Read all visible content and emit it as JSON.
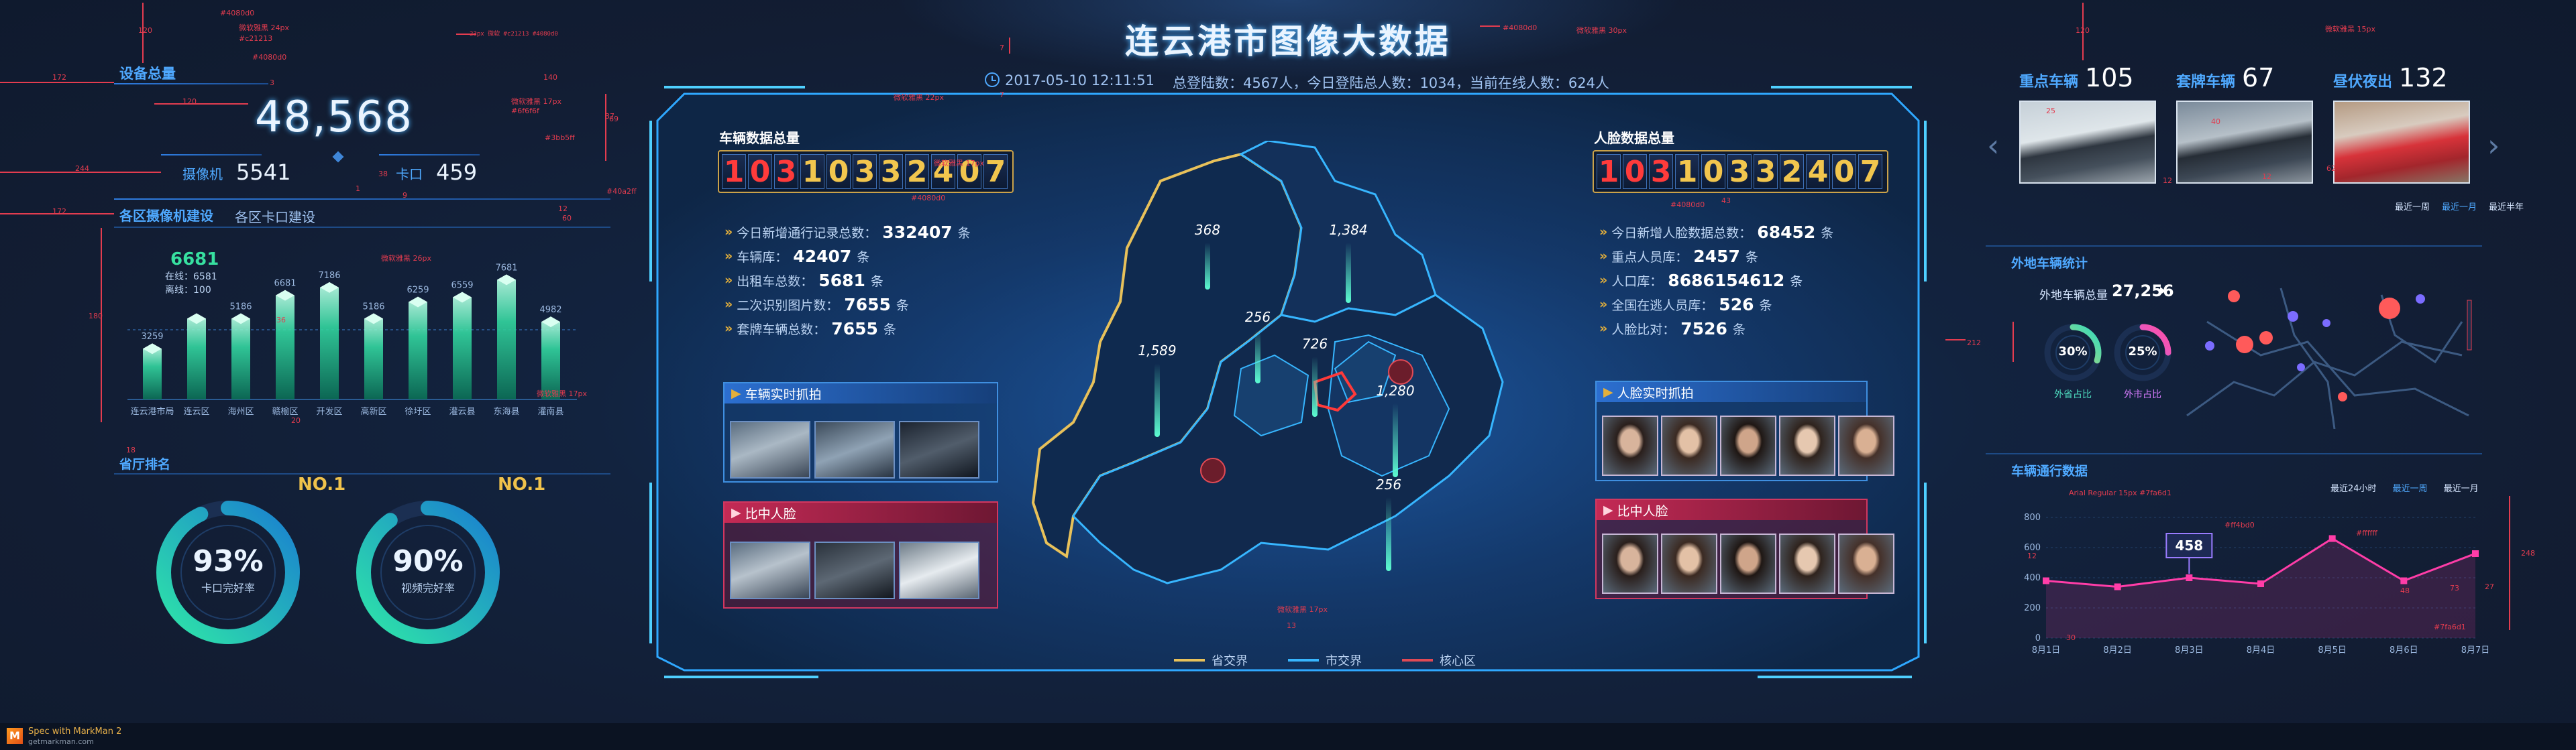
{
  "header": {
    "title": "连云港市图像大数据",
    "datetime": "2017-05-10 12:11:51",
    "stats": "总登陆数：4567人，今日登陆总人数：1034，当前在线人数：624人"
  },
  "left": {
    "device_total_title": "设备总量",
    "device_total": "48,568",
    "camera_label": "摄像机",
    "camera_count": "5541",
    "checkpoint_label": "卡口",
    "checkpoint_count": "459",
    "district_tab_1": "各区摄像机建设",
    "district_tab_2": "各区卡口建设",
    "highlight_value": "6681",
    "highlight_online": "在线：6581",
    "highlight_offline": "离线：100",
    "rank_title": "省厅排名",
    "gauges": [
      {
        "badge": "NO.1",
        "value": "93%",
        "label": "卡口完好率",
        "fraction": 0.93
      },
      {
        "badge": "NO.1",
        "value": "90%",
        "label": "视频完好率",
        "fraction": 0.9
      }
    ]
  },
  "chart_data": [
    {
      "type": "bar",
      "categories": [
        "连云港市局",
        "连云区",
        "海州区",
        "赣榆区",
        "开发区",
        "高新区",
        "徐圩区",
        "灌云县",
        "东海县",
        "灌南县"
      ],
      "values": [
        3259,
        5186,
        5186,
        6681,
        7186,
        5186,
        6259,
        6559,
        7681,
        4982
      ],
      "value_labels": [
        "3259",
        "",
        "5186",
        "6681",
        "7186",
        "5186",
        "6259",
        "6559",
        "7681",
        "4982"
      ],
      "ylim": [
        0,
        8000
      ]
    },
    {
      "type": "line",
      "title": "车辆通行数据",
      "categories": [
        "8月1日",
        "8月2日",
        "8月3日",
        "8月4日",
        "8月5日",
        "8月6日",
        "8月7日"
      ],
      "values": [
        380,
        340,
        400,
        360,
        660,
        380,
        560
      ],
      "highlight_label": "458",
      "ylim": [
        0,
        800
      ],
      "yticks": [
        "0",
        "200",
        "400",
        "600",
        "800"
      ]
    }
  ],
  "center": {
    "vehicle_title": "车辆数据总量",
    "vehicle_digits": [
      "1",
      "0",
      "3",
      "1",
      "0",
      "3",
      "3",
      "2",
      "4",
      "0",
      "7"
    ],
    "vehicle_stats": [
      {
        "label": "今日新增通行记录总数：",
        "value": "332407",
        "unit": "条"
      },
      {
        "label": "车辆库：",
        "value": "42407",
        "unit": "条"
      },
      {
        "label": "出租车总数：",
        "value": "5681",
        "unit": "条"
      },
      {
        "label": "二次识别图片数：",
        "value": "7655",
        "unit": "条"
      },
      {
        "label": "套牌车辆总数：",
        "value": "7655",
        "unit": "条"
      }
    ],
    "vehicle_capture_title": "车辆实时抓拍",
    "match_face_title": "比中人脸",
    "face_title": "人脸数据总量",
    "face_digits": [
      "1",
      "0",
      "3",
      "1",
      "0",
      "3",
      "3",
      "2",
      "4",
      "0",
      "7"
    ],
    "face_stats": [
      {
        "label": "今日新增人脸数据总数：",
        "value": "68452",
        "unit": "条"
      },
      {
        "label": "重点人员库：",
        "value": "2457",
        "unit": "条"
      },
      {
        "label": "人口库：",
        "value": "8686154612",
        "unit": "条"
      },
      {
        "label": "全国在逃人员库：",
        "value": "526",
        "unit": "条"
      },
      {
        "label": "人脸比对：",
        "value": "7526",
        "unit": "条"
      }
    ],
    "face_capture_title": "人脸实时抓拍",
    "match_face_title_2": "比中人脸",
    "map_values": [
      "368",
      "1,384",
      "256",
      "726",
      "1,589",
      "1,280",
      "256"
    ],
    "legend": [
      {
        "label": "省交界",
        "color": "#e8c15a"
      },
      {
        "label": "市交界",
        "color": "#37b6ff"
      },
      {
        "label": "核心区",
        "color": "#e04a55"
      }
    ]
  },
  "right": {
    "key_vehicle": {
      "label": "重点车辆",
      "value": "105"
    },
    "fake_plate": {
      "label": "套牌车辆",
      "value": "67"
    },
    "night_out": {
      "label": "昼伏夜出",
      "value": "132"
    },
    "periods": [
      "最近一周",
      "最近一月",
      "最近半年"
    ],
    "nonlocal_title": "外地车辆统计",
    "nonlocal_total_label": "外地车辆总量",
    "nonlocal_total": "27,256",
    "ring1": {
      "value": "30%",
      "label": "外省占比",
      "fraction": 0.3
    },
    "ring2": {
      "value": "25%",
      "label": "外市占比",
      "fraction": 0.25
    },
    "traffic_title": "车辆通行数据",
    "traffic_periods": [
      "最近24小时",
      "最近一周",
      "最近一月"
    ]
  },
  "footer": {
    "brand": "Spec with MarkMan 2",
    "url": "getmarkman.com"
  },
  "annotations": {
    "m1": "#4080d0",
    "m2": "#4080d0",
    "m3": "微软雅黑 24px",
    "m4": "#c21213",
    "m5": "23px 微软 #c21213 #4080d0",
    "m6": "140",
    "m7": "微软雅黑 17px",
    "m8": "#6f6f6f",
    "m9": "微软雅黑 26px",
    "m10": "#3bb5ff",
    "m11": "微软雅黑 17px",
    "m12": "#4080d0",
    "m13": "微软雅黑 30px",
    "m14": "#40a2ff",
    "m15": "#4080d0",
    "m16": "微软雅黑 22px",
    "m17": "#4080d0",
    "m18": "微软雅黑 17px",
    "m19": "Arial Regular 15px #7fa6d1",
    "m20": "#7fa6d1",
    "m21": "#ff4bd0",
    "m22": "#ffffff",
    "m23": "微软雅黑 15px",
    "m24": "微软雅黑 17px",
    "n1": "120",
    "n2": "172",
    "n3": "3",
    "n4": "120",
    "n5": "244",
    "n6": "172",
    "n7": "38",
    "n8": "1",
    "n9": "9",
    "n10": "7",
    "n11": "37",
    "n12": "12",
    "n13": "60",
    "n14": "36",
    "n15": "20",
    "n16": "180",
    "n17": "18",
    "n18": "120",
    "n19": "212",
    "n20": "25",
    "n21": "40",
    "n22": "12",
    "n23": "7",
    "n24": "12",
    "n25": "62",
    "n26": "73",
    "n27": "27",
    "n28": "30",
    "n29": "48",
    "n30": "248",
    "n31": "12",
    "n32": "69",
    "n33": "13",
    "n34": "43"
  }
}
